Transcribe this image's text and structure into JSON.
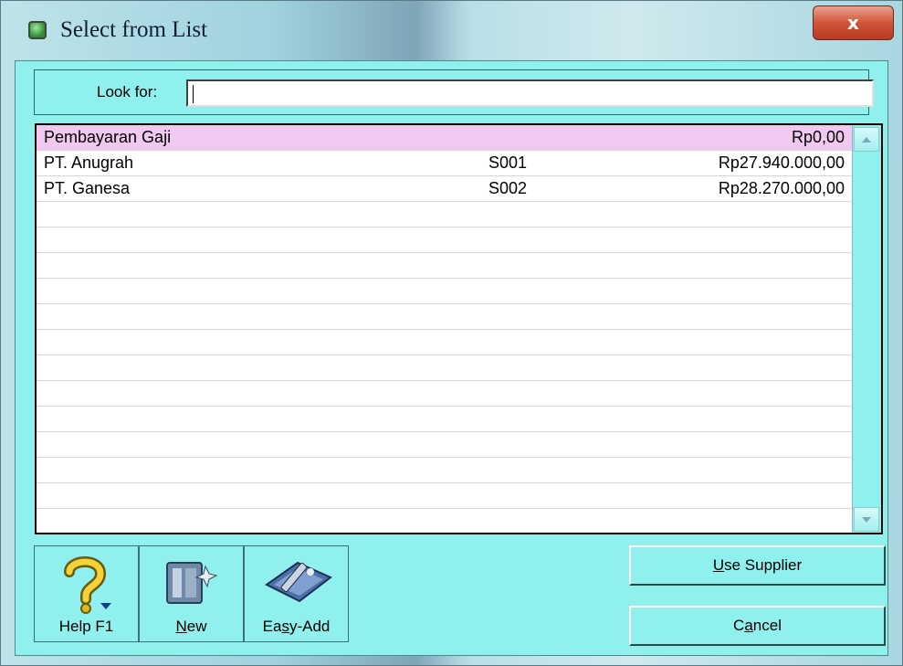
{
  "window": {
    "title": "Select from List",
    "close_glyph": "x"
  },
  "search": {
    "label": "Look for:",
    "value": "",
    "placeholder": ""
  },
  "list": {
    "rows": [
      {
        "name": "Pembayaran Gaji",
        "code": "",
        "amount": "Rp0,00",
        "selected": true
      },
      {
        "name": "PT. Anugrah",
        "code": "S001",
        "amount": "Rp27.940.000,00",
        "selected": false
      },
      {
        "name": "PT. Ganesa",
        "code": "S002",
        "amount": "Rp28.270.000,00",
        "selected": false
      }
    ],
    "selected_row_color": "#f0c8f0"
  },
  "toolbar": {
    "help_label": "Help F1",
    "new_label": "New",
    "easy_add_label": "Easy-Add"
  },
  "actions": {
    "use_supplier_label": "Use Supplier",
    "cancel_label": "Cancel"
  },
  "icons": {
    "app": "app-icon",
    "close": "close-icon",
    "help": "help-question-icon",
    "new": "new-document-icon",
    "easy_add": "easy-add-tool-icon",
    "scroll_up": "scroll-up-arrow-icon",
    "scroll_down": "scroll-down-arrow-icon"
  },
  "colors": {
    "client_bg": "#8ff0ee",
    "close_button": "#c8452c"
  }
}
